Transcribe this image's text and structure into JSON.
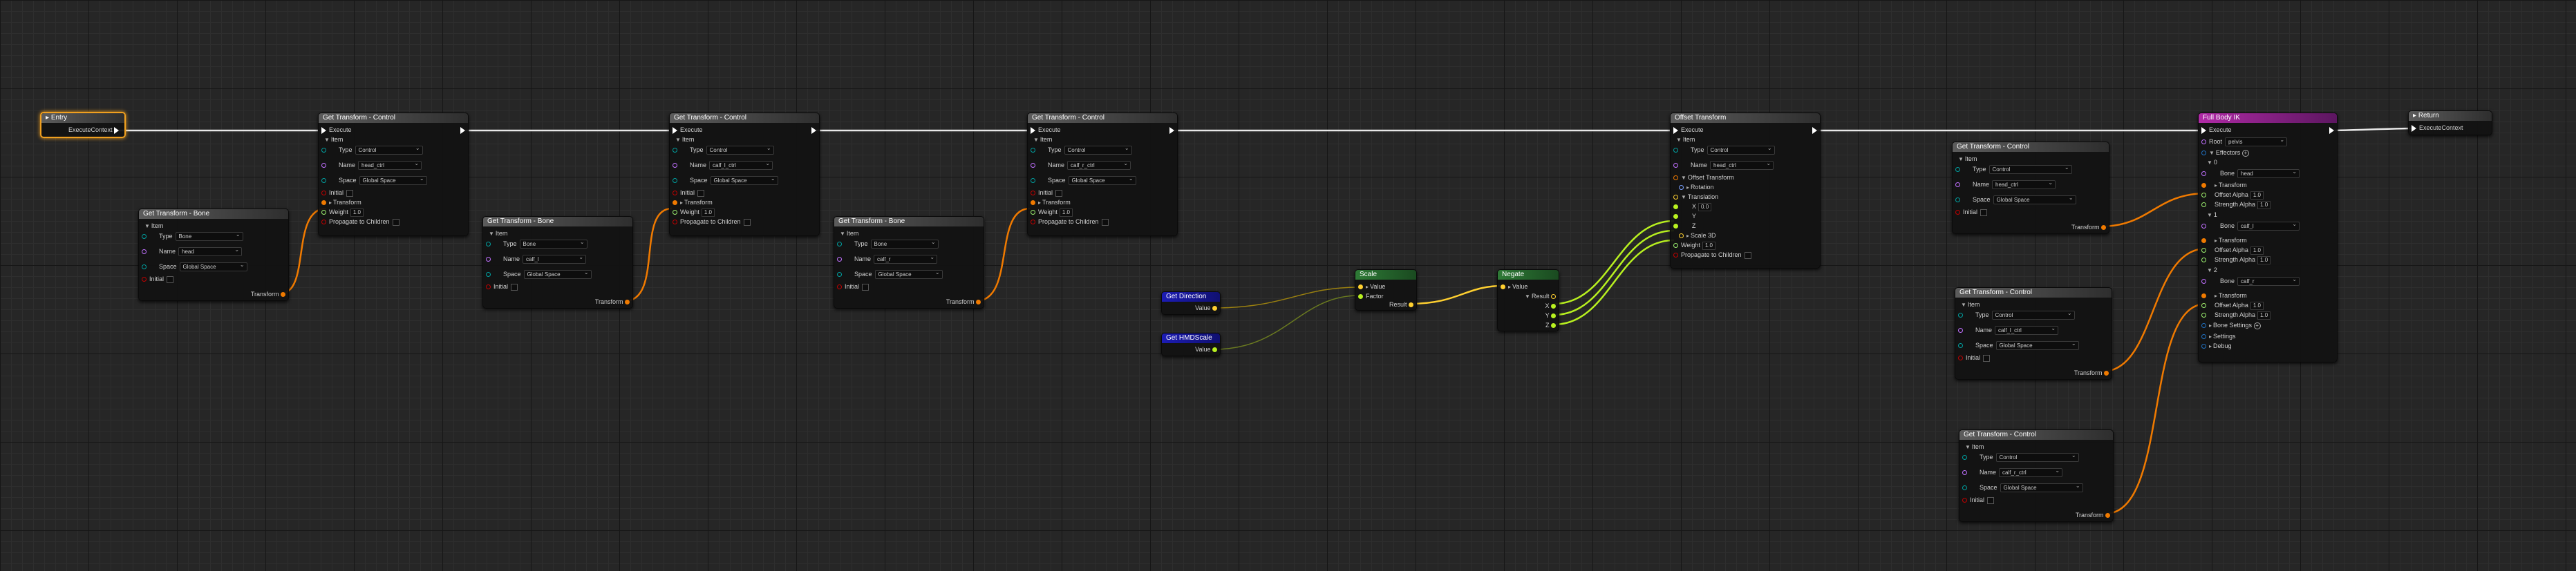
{
  "nodes": {
    "entry": {
      "title": "Entry",
      "out": "ExecuteContext"
    },
    "return": {
      "title": "Return",
      "in": "ExecuteContext"
    },
    "execute_label": "Execute",
    "item_label": "Item",
    "type_label": "Type",
    "name_label": "Name",
    "space_label": "Space",
    "initial_label": "Initial",
    "transform_label": "Transform",
    "weight_label": "Weight",
    "weight_value": "1.0",
    "propagate_label": "Propagate to Children",
    "control_type": "Control",
    "bone_type": "Bone",
    "space_value": "Global Space",
    "gtc_title": "Get Transform - Control",
    "gtb_title": "Get Transform - Bone",
    "names": {
      "bone1": "head",
      "ctrl1": "head_ctrl",
      "bone2": "calf_l",
      "ctrl2": "calf_l_ctrl",
      "bone3": "calf_r",
      "ctrl3": "calf_r_ctrl",
      "offset_ctrl": "head_ctrl",
      "right1": "head_ctrl",
      "right2": "calf_l_ctrl",
      "right3": "calf_r_ctrl"
    },
    "offset": {
      "title": "Offset Transform",
      "offset_transform": "Offset Transform",
      "rotation": "Rotation",
      "translation": "Translation",
      "x": "X",
      "x_value": "0.0",
      "y": "Y",
      "z": "Z",
      "scale3d": "Scale 3D"
    },
    "get_direction": {
      "title": "Get Direction",
      "value": "Value"
    },
    "get_hmd_scale": {
      "title": "Get HMDScale",
      "value": "Value"
    },
    "scale": {
      "title": "Scale",
      "value": "Value",
      "factor": "Factor",
      "result": "Result"
    },
    "negate": {
      "title": "Negate",
      "value": "Value",
      "result": "Result",
      "x": "X",
      "y": "Y",
      "z": "Z"
    },
    "fullbody": {
      "title": "Full Body IK",
      "root": "Root",
      "root_value": "pelvis",
      "effectors": "Effectors",
      "e0": "0",
      "e1": "1",
      "e2": "2",
      "bone": "Bone",
      "bone0": "head",
      "bone1": "calf_l",
      "bone2": "calf_r",
      "transform": "Transform",
      "offset_alpha": "Offset Alpha",
      "strength_alpha": "Strength Alpha",
      "alpha_value": "1.0",
      "bone_settings": "Bone Settings",
      "settings": "Settings",
      "debug": "Debug"
    }
  },
  "colors": {
    "exec": "#ffffff",
    "transform_wire": "#f07a00",
    "vector_wire": "#b8f020",
    "float_wire": "#ffd030",
    "struct_pin": "#2070c0",
    "name_pin": "#c070ff",
    "enum_pin": "#00a0a0",
    "bool_pin": "#c00000"
  }
}
